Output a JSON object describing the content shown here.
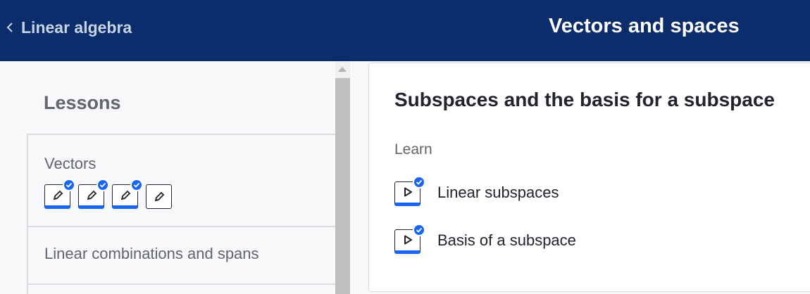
{
  "header": {
    "back_label": "Linear algebra",
    "title": "Vectors and spaces",
    "background": "#0b2d6b"
  },
  "sidebar": {
    "heading": "Lessons",
    "lessons": [
      {
        "title": "Vectors",
        "skills": [
          {
            "icon": "pencil-icon",
            "completed": true
          },
          {
            "icon": "pencil-icon",
            "completed": true
          },
          {
            "icon": "pencil-icon",
            "completed": true
          },
          {
            "icon": "pencil-icon",
            "completed": false
          }
        ]
      },
      {
        "title": "Linear combinations and spans"
      }
    ]
  },
  "main": {
    "lesson_title": "Subspaces and the basis for a subspace",
    "section_label": "Learn",
    "items": [
      {
        "label": "Linear subspaces",
        "icon": "video-play-icon",
        "completed": true
      },
      {
        "label": "Basis of a subspace",
        "icon": "video-play-icon",
        "completed": true
      }
    ]
  },
  "colors": {
    "accent": "#1865f2",
    "text": "#21242c",
    "muted": "#626569"
  }
}
